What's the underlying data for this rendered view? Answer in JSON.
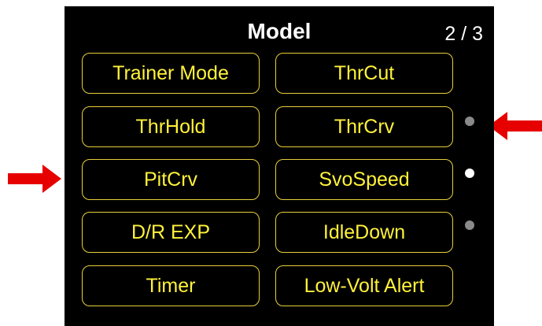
{
  "screen": {
    "title": "Model",
    "page_indicator": "2 / 3"
  },
  "buttons": [
    {
      "label": "Trainer Mode"
    },
    {
      "label": "ThrCut"
    },
    {
      "label": "ThrHold"
    },
    {
      "label": "ThrCrv"
    },
    {
      "label": "PitCrv"
    },
    {
      "label": "SvoSpeed"
    },
    {
      "label": "D/R EXP"
    },
    {
      "label": "IdleDown"
    },
    {
      "label": "Timer"
    },
    {
      "label": "Low-Volt Alert"
    }
  ],
  "page_dots": {
    "count": 3,
    "active_index": 1,
    "active_color": "#ffffff",
    "inactive_color": "#8a8a8a"
  },
  "colors": {
    "background": "#000000",
    "button_border": "#e7cf3c",
    "button_text": "#fff23a",
    "annotation_arrow": "#e60000"
  },
  "icons": {
    "annotation_left": "arrow-right-icon",
    "annotation_right": "arrow-left-icon"
  }
}
